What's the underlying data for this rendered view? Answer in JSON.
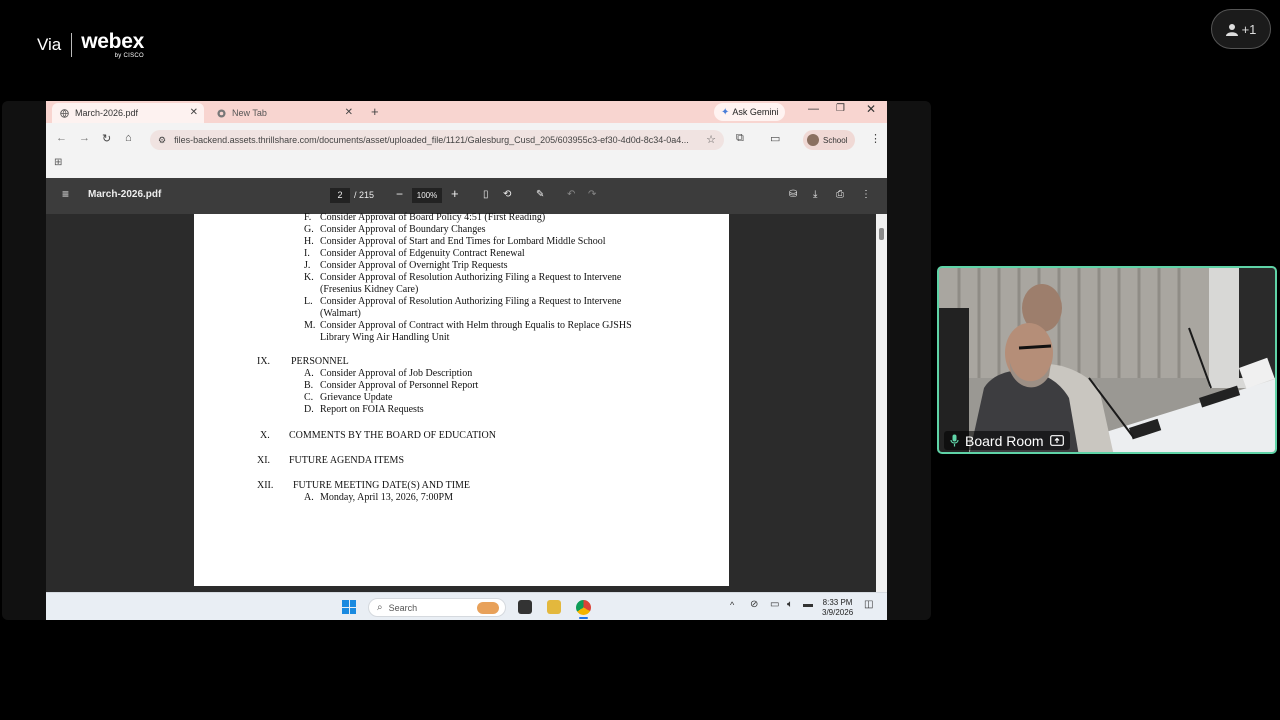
{
  "logo": {
    "via": "Via",
    "brand": "webex",
    "by": "by CISCO"
  },
  "participants": {
    "count_label": "+1",
    "icon": "person-icon"
  },
  "browser": {
    "tabs": [
      {
        "label": "March-2026.pdf",
        "icon": "globe-icon"
      },
      {
        "label": "New Tab",
        "icon": "chrome-icon"
      }
    ],
    "new_tab": "+",
    "gemini_label": "Ask Gemini",
    "url": "files-backend.assets.thrillshare.com/documents/asset/uploaded_file/1121/Galesburg_Cusd_205/603955c3-ef30-4d0d-8c34-0a4...",
    "profile_label": "School"
  },
  "pdf": {
    "filename": "March-2026.pdf",
    "current_page": "2",
    "total_pages": "/ 215",
    "zoom": "100%",
    "lines": [
      {
        "marker": "F.",
        "text": "Consider Approval of Board Policy 4:51 (First Reading)"
      },
      {
        "marker": "G.",
        "text": "Consider Approval of Boundary Changes"
      },
      {
        "marker": "H.",
        "text": "Consider Approval of Start and End Times for Lombard Middle School"
      },
      {
        "marker": "I.",
        "text": "Consider Approval of Edgenuity Contract Renewal"
      },
      {
        "marker": "J.",
        "text": "Consider Approval of Overnight Trip Requests"
      },
      {
        "marker": "K.",
        "text": "Consider Approval of Resolution Authorizing Filing a Request to Intervene"
      },
      {
        "marker": "",
        "text": "(Fresenius Kidney Care)"
      },
      {
        "marker": "L.",
        "text": "Consider Approval of Resolution Authorizing Filing a Request to Intervene"
      },
      {
        "marker": "",
        "text": "(Walmart)"
      },
      {
        "marker": "M.",
        "text": "Consider Approval of Contract with Helm through Equalis to Replace GJSHS"
      },
      {
        "marker": "",
        "text": "Library Wing Air Handling Unit"
      }
    ],
    "sections": [
      {
        "numeral": "IX.",
        "title": "PERSONNEL",
        "items": [
          {
            "marker": "A.",
            "text": "Consider Approval of Job Description"
          },
          {
            "marker": "B.",
            "text": "Consider Approval of Personnel Report"
          },
          {
            "marker": "C.",
            "text": "Grievance Update"
          },
          {
            "marker": "D.",
            "text": "Report on FOIA Requests"
          }
        ]
      },
      {
        "numeral": "X.",
        "title": "COMMENTS BY THE BOARD OF EDUCATION"
      },
      {
        "numeral": "XI.",
        "title": "FUTURE AGENDA ITEMS"
      },
      {
        "numeral": "XII.",
        "title": "FUTURE MEETING DATE(S) AND TIME",
        "items": [
          {
            "marker": "A.",
            "text": "Monday, April 13, 2026, 7:00PM"
          }
        ]
      }
    ]
  },
  "taskbar": {
    "search_placeholder": "Search",
    "time": "8:33 PM",
    "date": "3/9/2026"
  },
  "video": {
    "room_label": "Board Room"
  },
  "colors": {
    "tile_border": "#5fd3a7",
    "tab_strip": "#f8d5d0",
    "pdf_toolbar": "#3c3c3c"
  }
}
